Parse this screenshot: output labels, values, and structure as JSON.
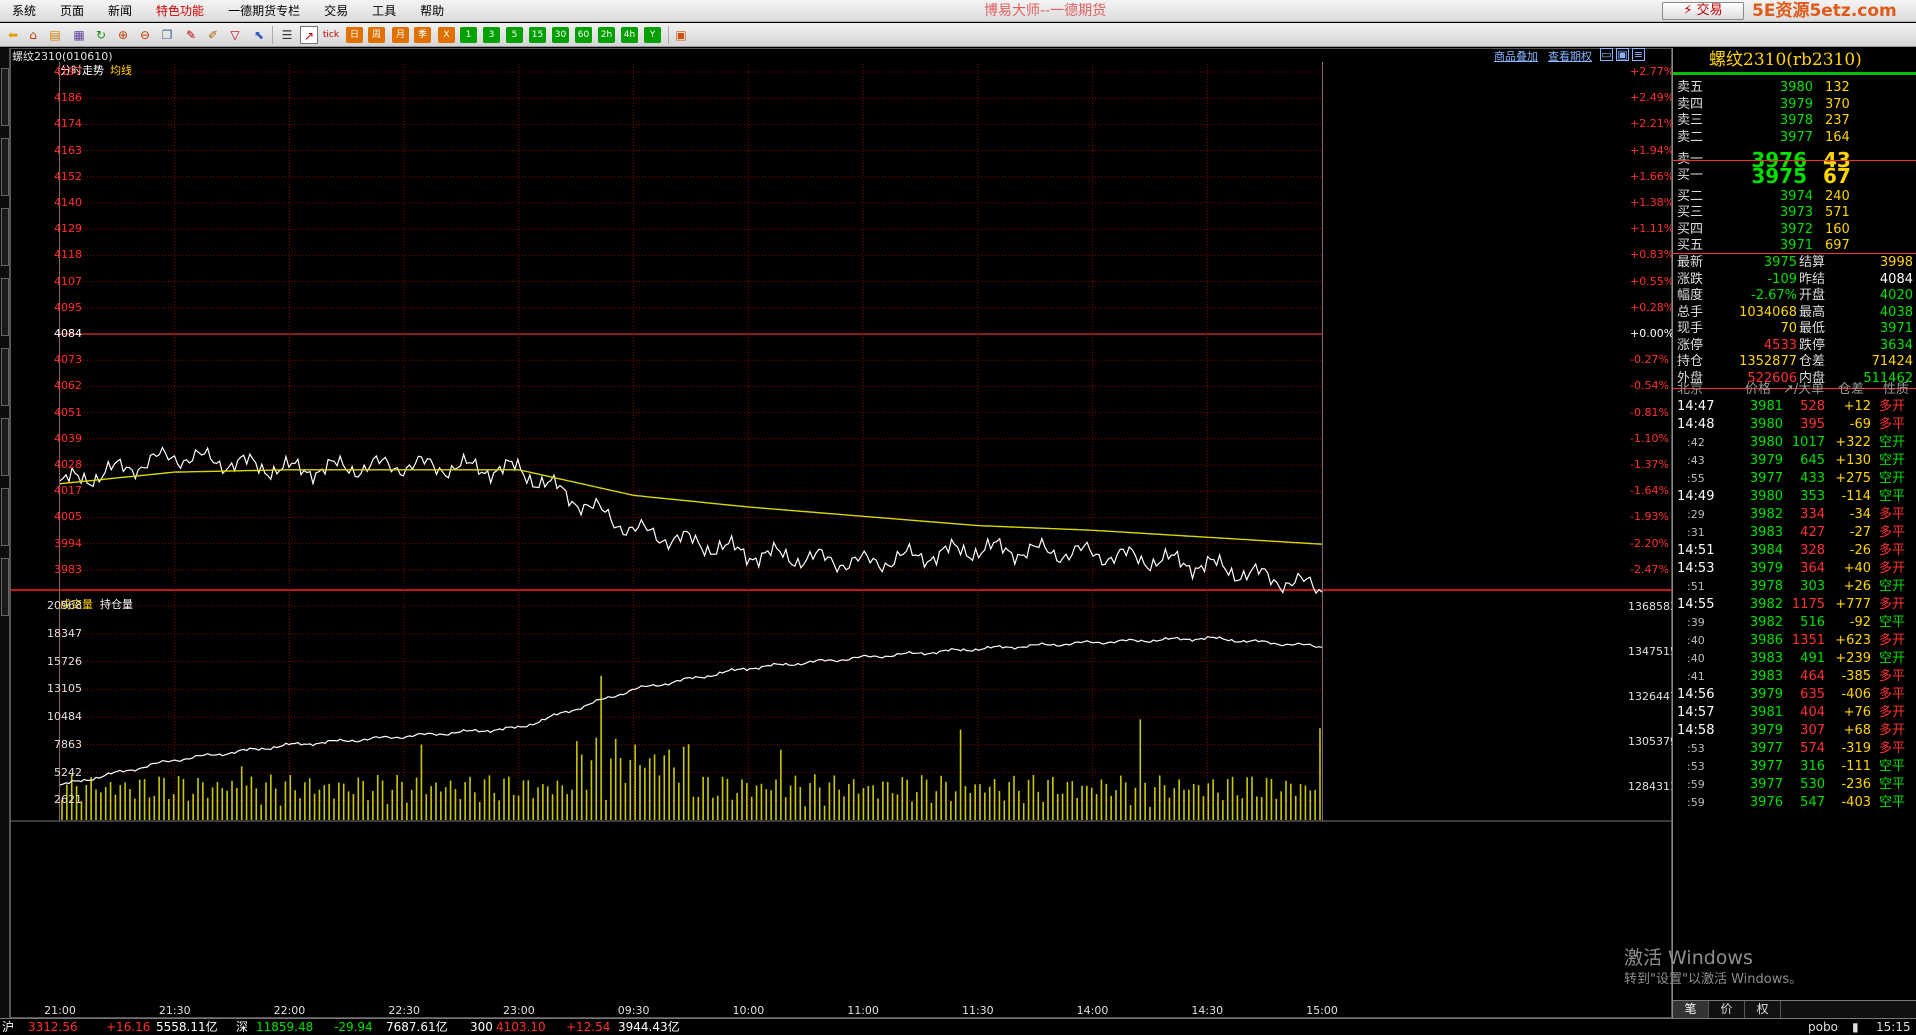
{
  "menubar": {
    "items": [
      "系统",
      "页面",
      "新闻",
      "特色功能",
      "一德期货专栏",
      "交易",
      "工具",
      "帮助"
    ],
    "highlight_index": 3,
    "app_title": "博易大师--一德期货",
    "trade_button": "⚡ 交易",
    "logo_text": "5E资源5etz.com"
  },
  "toolbar": {
    "period_buttons": [
      "1",
      "3",
      "5",
      "15",
      "30",
      "60",
      "2h",
      "4h",
      "Y"
    ]
  },
  "chart": {
    "instrument": "螺纹2310(010610)",
    "links": [
      "商品叠加",
      "查看期权"
    ],
    "price_panel": {
      "label1": "分时走势",
      "label2": "均线"
    },
    "volume_panel": {
      "label1": "成交量",
      "label2": "持仓量"
    },
    "price_ticks": [
      "4197",
      "4186",
      "4174",
      "4163",
      "4152",
      "4140",
      "4129",
      "4118",
      "4107",
      "4095",
      "4084",
      "4073",
      "4062",
      "4051",
      "4039",
      "4028",
      "4017",
      "4005",
      "3994",
      "3983"
    ],
    "pct_ticks": [
      "+2.77%",
      "+2.49%",
      "+2.21%",
      "+1.94%",
      "+1.66%",
      "+1.38%",
      "+1.11%",
      "+0.83%",
      "+0.55%",
      "+0.28%",
      "+0.00%",
      "-0.27%",
      "-0.54%",
      "-0.81%",
      "-1.10%",
      "-1.37%",
      "-1.64%",
      "-1.93%",
      "-2.20%",
      "-2.47%"
    ],
    "volume_ticks": [
      "20968",
      "18347",
      "15726",
      "13105",
      "10484",
      "7863",
      "5242",
      "2621"
    ],
    "oi_ticks": [
      "1368583",
      "1347515",
      "1326447",
      "1305379",
      "1284311"
    ],
    "x_labels": [
      "21:00",
      "21:30",
      "22:00",
      "22:30",
      "23:00",
      "09:30",
      "10:00",
      "11:00",
      "11:30",
      "14:00",
      "14:30",
      "15:00"
    ],
    "colors": {
      "price": "#ffffff",
      "avg": "#d8d800",
      "volume": "#c8c800",
      "grid": "#aa0000",
      "oi": "#ffffff"
    }
  },
  "chart_data": {
    "type": "line",
    "title": "螺纹2310(010610)",
    "prev_settle": 4084,
    "ylim": [
      3983,
      4197
    ],
    "x": [
      "21:00",
      "21:30",
      "22:00",
      "22:30",
      "23:00",
      "09:30",
      "10:00",
      "11:00",
      "11:30",
      "14:00",
      "14:30",
      "15:00"
    ],
    "series": [
      {
        "name": "分时走势",
        "values": [
          4020,
          4032,
          4026,
          4028,
          4026,
          4000,
          3990,
          3986,
          3992,
          3990,
          3985,
          3975
        ]
      },
      {
        "name": "均线",
        "values": [
          4020,
          4025,
          4026,
          4026,
          4026,
          4015,
          4010,
          4006,
          4002,
          4000,
          3997,
          3994
        ]
      }
    ],
    "volume_series": {
      "name": "成交量",
      "ylim": [
        0,
        20968
      ]
    },
    "oi_series": {
      "name": "持仓量",
      "values": [
        1285000,
        1297000,
        1304000,
        1308000,
        1312000,
        1330000,
        1340000,
        1345000,
        1349000,
        1352000,
        1354000,
        1350000
      ]
    }
  },
  "quote": {
    "title": "螺纹2310(rb2310)",
    "asks": [
      {
        "label": "卖五",
        "price": "3980",
        "vol": "132"
      },
      {
        "label": "卖四",
        "price": "3979",
        "vol": "370"
      },
      {
        "label": "卖三",
        "price": "3978",
        "vol": "237"
      },
      {
        "label": "卖二",
        "price": "3977",
        "vol": "164"
      },
      {
        "label": "卖一",
        "price": "3976",
        "vol": "43"
      }
    ],
    "bids": [
      {
        "label": "买一",
        "price": "3975",
        "vol": "67"
      },
      {
        "label": "买二",
        "price": "3974",
        "vol": "240"
      },
      {
        "label": "买三",
        "price": "3973",
        "vol": "571"
      },
      {
        "label": "买四",
        "price": "3972",
        "vol": "160"
      },
      {
        "label": "买五",
        "price": "3971",
        "vol": "697"
      }
    ],
    "stats": [
      {
        "l1": "最新",
        "v1": "3975",
        "c1": "#00e000",
        "l2": "结算",
        "v2": "3998",
        "c2": "#ffd400"
      },
      {
        "l1": "涨跌",
        "v1": "-109",
        "c1": "#00e000",
        "l2": "昨结",
        "v2": "4084",
        "c2": "#ffffff"
      },
      {
        "l1": "幅度",
        "v1": "-2.67%",
        "c1": "#00e000",
        "l2": "开盘",
        "v2": "4020",
        "c2": "#00e000"
      },
      {
        "l1": "总手",
        "v1": "1034068",
        "c1": "#ffd400",
        "l2": "最高",
        "v2": "4038",
        "c2": "#00e000"
      },
      {
        "l1": "现手",
        "v1": "70",
        "c1": "#ffd400",
        "l2": "最低",
        "v2": "3971",
        "c2": "#00e000"
      },
      {
        "l1": "涨停",
        "v1": "4533",
        "c1": "#ff3030",
        "l2": "跌停",
        "v2": "3634",
        "c2": "#00e000"
      },
      {
        "l1": "持仓",
        "v1": "1352877",
        "c1": "#ffd400",
        "l2": "仓差",
        "v2": "71424",
        "c2": "#ffd400"
      },
      {
        "l1": "外盘",
        "v1": "522606",
        "c1": "#ff3030",
        "l2": "内盘",
        "v2": "511462",
        "c2": "#00e000"
      }
    ],
    "tick_headers": [
      "北京",
      "价格",
      "↗/大单",
      "仓差",
      "性质"
    ],
    "ticks": [
      {
        "time": "14:47",
        "price": "3981",
        "vol": "528",
        "chg": "+12",
        "type": "多开"
      },
      {
        "time": "14:48",
        "price": "3980",
        "vol": "395",
        "chg": "-69",
        "type": "多平"
      },
      {
        "time": ":42",
        "price": "3980",
        "vol": "1017",
        "chg": "+322",
        "type": "空开"
      },
      {
        "time": ":43",
        "price": "3979",
        "vol": "645",
        "chg": "+130",
        "type": "空开"
      },
      {
        "time": ":55",
        "price": "3977",
        "vol": "433",
        "chg": "+275",
        "type": "空开"
      },
      {
        "time": "14:49",
        "price": "3980",
        "vol": "353",
        "chg": "-114",
        "type": "空平"
      },
      {
        "time": ":29",
        "price": "3982",
        "vol": "334",
        "chg": "-34",
        "type": "多平"
      },
      {
        "time": ":31",
        "price": "3983",
        "vol": "427",
        "chg": "-27",
        "type": "多平"
      },
      {
        "time": "14:51",
        "price": "3984",
        "vol": "328",
        "chg": "-26",
        "type": "多平"
      },
      {
        "time": "14:53",
        "price": "3979",
        "vol": "364",
        "chg": "+40",
        "type": "多开"
      },
      {
        "time": ":51",
        "price": "3978",
        "vol": "303",
        "chg": "+26",
        "type": "空开"
      },
      {
        "time": "14:55",
        "price": "3982",
        "vol": "1175",
        "chg": "+777",
        "type": "多开"
      },
      {
        "time": ":39",
        "price": "3982",
        "vol": "516",
        "chg": "-92",
        "type": "空平"
      },
      {
        "time": ":40",
        "price": "3986",
        "vol": "1351",
        "chg": "+623",
        "type": "多开"
      },
      {
        "time": ":40",
        "price": "3983",
        "vol": "491",
        "chg": "+239",
        "type": "空开"
      },
      {
        "time": ":41",
        "price": "3983",
        "vol": "464",
        "chg": "-385",
        "type": "多平"
      },
      {
        "time": "14:56",
        "price": "3979",
        "vol": "635",
        "chg": "-406",
        "type": "多平"
      },
      {
        "time": "14:57",
        "price": "3981",
        "vol": "404",
        "chg": "+76",
        "type": "多开"
      },
      {
        "time": "14:58",
        "price": "3979",
        "vol": "307",
        "chg": "+68",
        "type": "多开"
      },
      {
        "time": ":53",
        "price": "3977",
        "vol": "574",
        "chg": "-319",
        "type": "多平"
      },
      {
        "time": ":53",
        "price": "3977",
        "vol": "316",
        "chg": "-111",
        "type": "空平"
      },
      {
        "time": ":59",
        "price": "3977",
        "vol": "530",
        "chg": "-236",
        "type": "空平"
      },
      {
        "time": ":59",
        "price": "3976",
        "vol": "547",
        "chg": "-403",
        "type": "空平"
      }
    ],
    "tabs": [
      "笔",
      "价",
      "权"
    ]
  },
  "activation": {
    "line1": "激活 Windows",
    "line2": "转到\"设置\"以激活 Windows。"
  },
  "statusbar": {
    "items": [
      {
        "text": "沪",
        "color": "#ffffff"
      },
      {
        "text": "3312.56",
        "color": "#ff3030"
      },
      {
        "text": "+16.16",
        "color": "#ff3030"
      },
      {
        "text": "5558.11亿",
        "color": "#ffffff"
      },
      {
        "text": "深",
        "color": "#ffffff"
      },
      {
        "text": "11859.48",
        "color": "#00e000"
      },
      {
        "text": "-29.94",
        "color": "#00e000"
      },
      {
        "text": "7687.61亿",
        "color": "#ffffff"
      },
      {
        "text": "300",
        "color": "#ffffff"
      },
      {
        "text": "4103.10",
        "color": "#ff3030"
      },
      {
        "text": "+12.54",
        "color": "#ff3030"
      },
      {
        "text": "3944.43亿",
        "color": "#ffffff"
      }
    ],
    "brand": "pobo",
    "clock": "15:15"
  }
}
